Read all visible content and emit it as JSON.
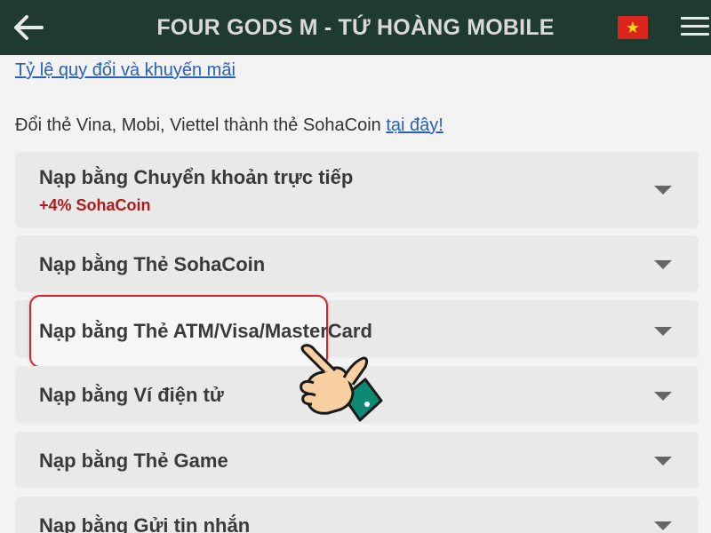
{
  "header": {
    "title": "FOUR GODS M - TỨ HOÀNG MOBILE",
    "flag_star": "★",
    "flag_color": "#da251d",
    "star_color": "#ffde00",
    "bg_color": "#1f3b31"
  },
  "links": {
    "exchange_rate": "Tỷ lệ quy đổi và khuyến mãi"
  },
  "info": {
    "text": "Đổi thẻ Vina, Mobi, Viettel thành thẻ SohaCoin ",
    "link": "tại đây!"
  },
  "payment_methods": [
    {
      "label": "Nạp bằng Chuyển khoản trực tiếp",
      "sub": "+4% SohaCoin"
    },
    {
      "label": "Nạp bằng Thẻ SohaCoin"
    },
    {
      "label": "Nạp bằng Thẻ ATM/Visa/MasterCard",
      "highlighted": true
    },
    {
      "label": "Nạp bằng Ví điện tử"
    },
    {
      "label": "Nạp bằng Thẻ Game"
    },
    {
      "label": "Nạp bằng Gửi tin nhắn"
    }
  ],
  "icons": {
    "back": "back-arrow-icon",
    "menu": "hamburger-menu-icon",
    "expand": "chevron-down-icon",
    "pointer": "pointing-hand-icon"
  }
}
